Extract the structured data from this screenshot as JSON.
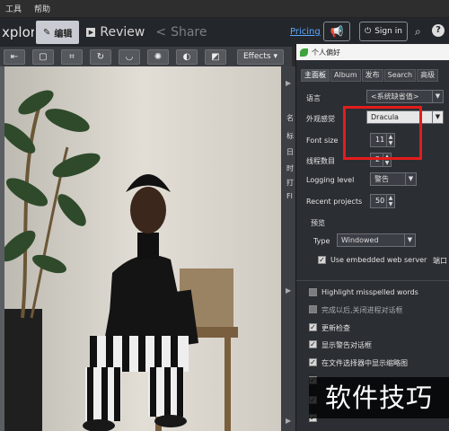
{
  "menubar": {
    "items": [
      "工具",
      "帮助"
    ]
  },
  "toolbar": {
    "explore_label": "xplore",
    "edit_label": "编辑",
    "review_label": "Review",
    "share_label": "Share",
    "pricing_label": "Pricing",
    "signin_label": "Sign in"
  },
  "tools": {
    "effects_label": "Effects"
  },
  "strip": {
    "chars": [
      "名",
      "标",
      "日",
      "时",
      "打",
      "Fl"
    ]
  },
  "dialog": {
    "title": "个人偏好",
    "tabs": [
      "主面板",
      "Album",
      "发布",
      "Search",
      "高级"
    ],
    "language_label": "语言",
    "language_value": "<系统缺省值>",
    "appearance_label": "外观感觉",
    "appearance_value": "Dracula",
    "fontsize_label": "Font size",
    "fontsize_value": "11",
    "threads_label": "线程数目",
    "threads_value": "2",
    "logging_label": "Logging level",
    "logging_value": "警告",
    "recent_label": "Recent projects",
    "recent_value": "50",
    "preview_group": "预览",
    "type_label": "Type",
    "type_value": "Windowed",
    "embedded_label": "Use embedded web server",
    "port_label": "端口",
    "checkboxes": [
      {
        "label": "Highlight misspelled words",
        "checked": false
      },
      {
        "label": "完成以后,关闭进程对话框",
        "checked": false
      },
      {
        "label": "更新检查",
        "checked": true
      },
      {
        "label": "显示警告对话框",
        "checked": true
      },
      {
        "label": "在文件选择器中显示缩略图",
        "checked": true
      }
    ]
  },
  "watermark": "软件技巧",
  "colors": {
    "accent_blue": "#5aa8ff",
    "annotation_red": "#e41c1c",
    "dialog_bg": "#2b2e33"
  }
}
